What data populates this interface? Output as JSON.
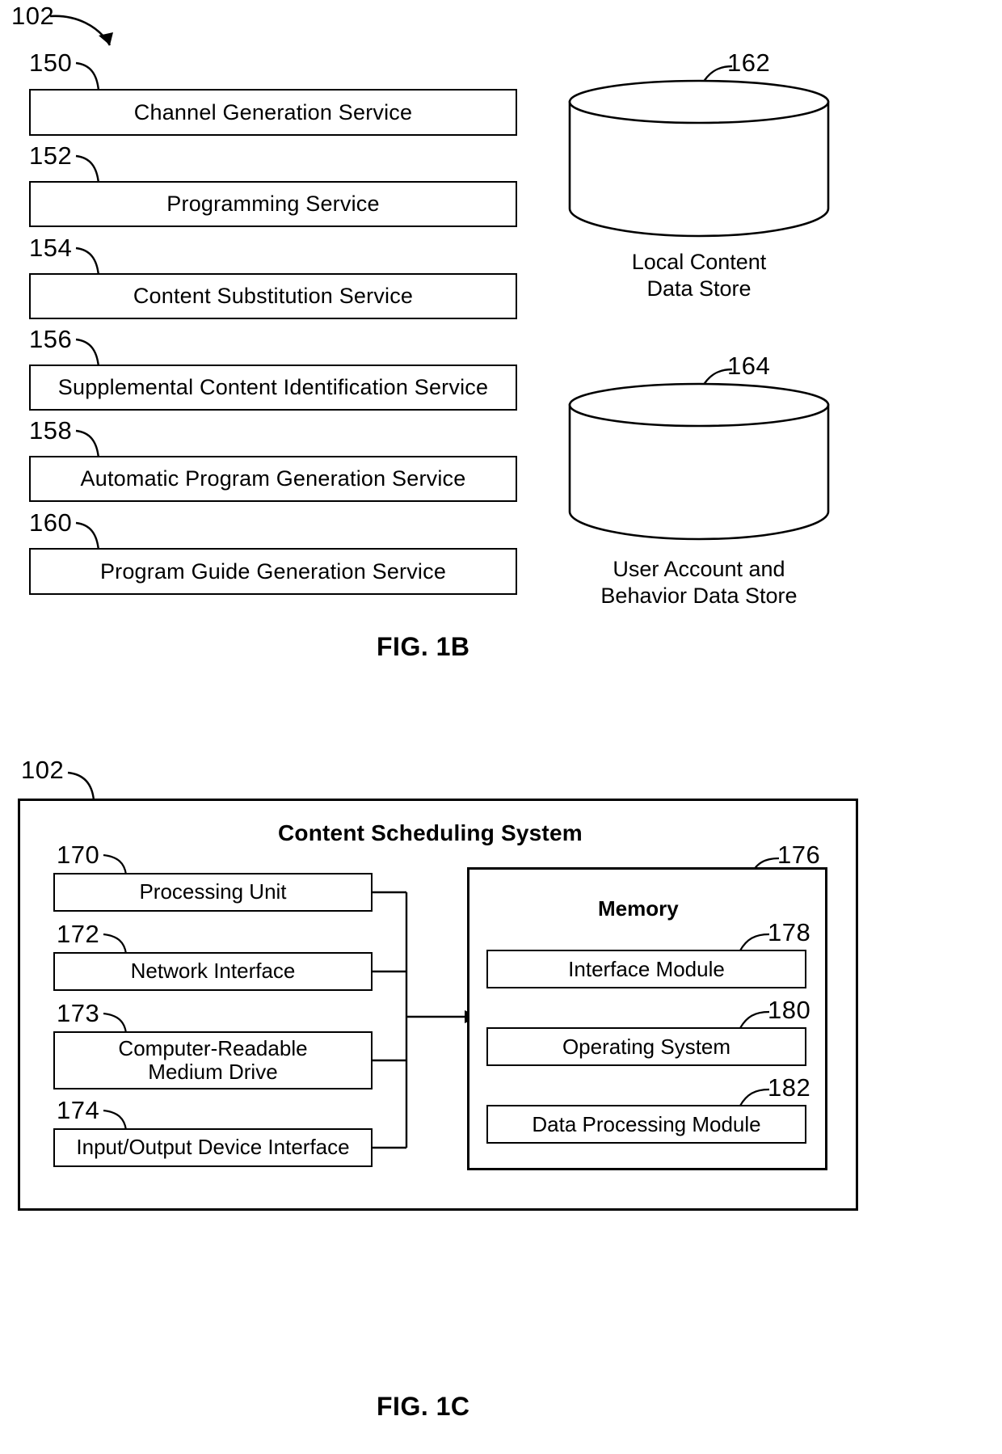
{
  "figures": [
    {
      "id": "fig-1b",
      "caption": "FIG. 1B",
      "system_ref": "102",
      "services": [
        {
          "ref": "150",
          "label": "Channel Generation Service"
        },
        {
          "ref": "152",
          "label": "Programming Service"
        },
        {
          "ref": "154",
          "label": "Content Substitution Service"
        },
        {
          "ref": "156",
          "label": "Supplemental Content Identification Service"
        },
        {
          "ref": "158",
          "label": "Automatic Program Generation Service"
        },
        {
          "ref": "160",
          "label": "Program Guide Generation Service"
        }
      ],
      "data_stores": [
        {
          "ref": "162",
          "label": "Local Content\nData Store"
        },
        {
          "ref": "164",
          "label": "User Account and\nBehavior Data Store"
        }
      ]
    },
    {
      "id": "fig-1c",
      "caption": "FIG. 1C",
      "system_ref": "102",
      "title": "Content Scheduling System",
      "hardware": [
        {
          "ref": "170",
          "label": "Processing Unit"
        },
        {
          "ref": "172",
          "label": "Network Interface"
        },
        {
          "ref": "173",
          "label": "Computer-Readable\nMedium Drive"
        },
        {
          "ref": "174",
          "label": "Input/Output Device Interface"
        }
      ],
      "memory": {
        "ref": "176",
        "title": "Memory",
        "modules": [
          {
            "ref": "178",
            "label": "Interface Module"
          },
          {
            "ref": "180",
            "label": "Operating System"
          },
          {
            "ref": "182",
            "label": "Data Processing Module"
          }
        ]
      }
    }
  ],
  "colors": {
    "stroke": "#000000",
    "background": "#ffffff"
  }
}
